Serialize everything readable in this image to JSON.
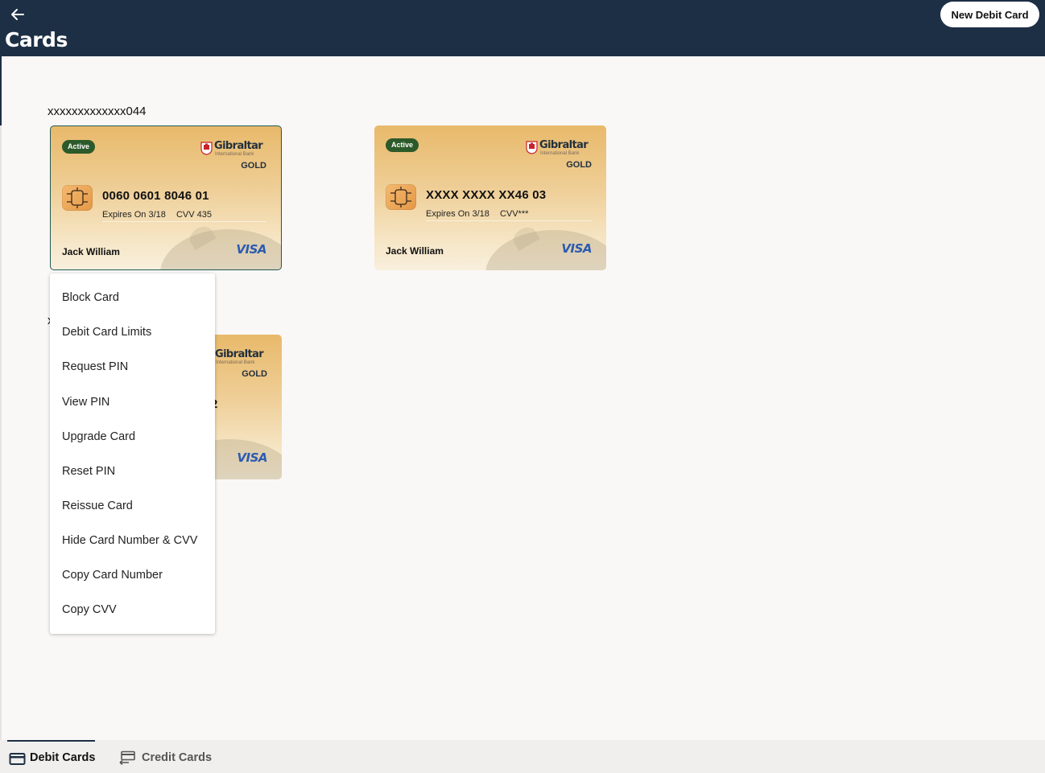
{
  "header": {
    "title": "Cards",
    "new_card_label": "New Debit Card"
  },
  "cards": [
    {
      "account": "xxxxxxxxxxxxx044",
      "status": "Active",
      "brand": "Gibraltar",
      "sub_brand": "International Bank",
      "tier": "GOLD",
      "number": "0060 0601 8046 01",
      "expiry": "Expires On 3/18",
      "cvv": "CVV 435",
      "holder": "Jack William",
      "network": "VISA"
    },
    {
      "status": "Active",
      "brand": "Gibraltar",
      "sub_brand": "International Bank",
      "tier": "GOLD",
      "number": "XXXX XXXX XX46 03",
      "expiry": "Expires On 3/18",
      "cvv": "CVV***",
      "holder": "Jack William",
      "network": "VISA"
    },
    {
      "account_partial": "x",
      "brand": "Gibraltar",
      "sub_brand": "International Bank",
      "tier": "GOLD",
      "number_partial": "2",
      "network": "VISA"
    }
  ],
  "menu": {
    "items": [
      "Block Card",
      "Debit Card Limits",
      "Request PIN",
      "View PIN",
      "Upgrade Card",
      "Reset PIN",
      "Reissue Card",
      "Hide Card Number & CVV",
      "Copy Card Number",
      "Copy CVV"
    ]
  },
  "tabs": [
    {
      "label": "Debit Cards",
      "active": true,
      "icon": "card-icon"
    },
    {
      "label": "Credit Cards",
      "active": false,
      "icon": "card-transfer-icon"
    }
  ],
  "colors": {
    "header_bg": "#1d2f45",
    "badge_bg": "#2c5a2a",
    "visa_blue": "#2b5bb0",
    "card_gold": "#e8b96a"
  }
}
